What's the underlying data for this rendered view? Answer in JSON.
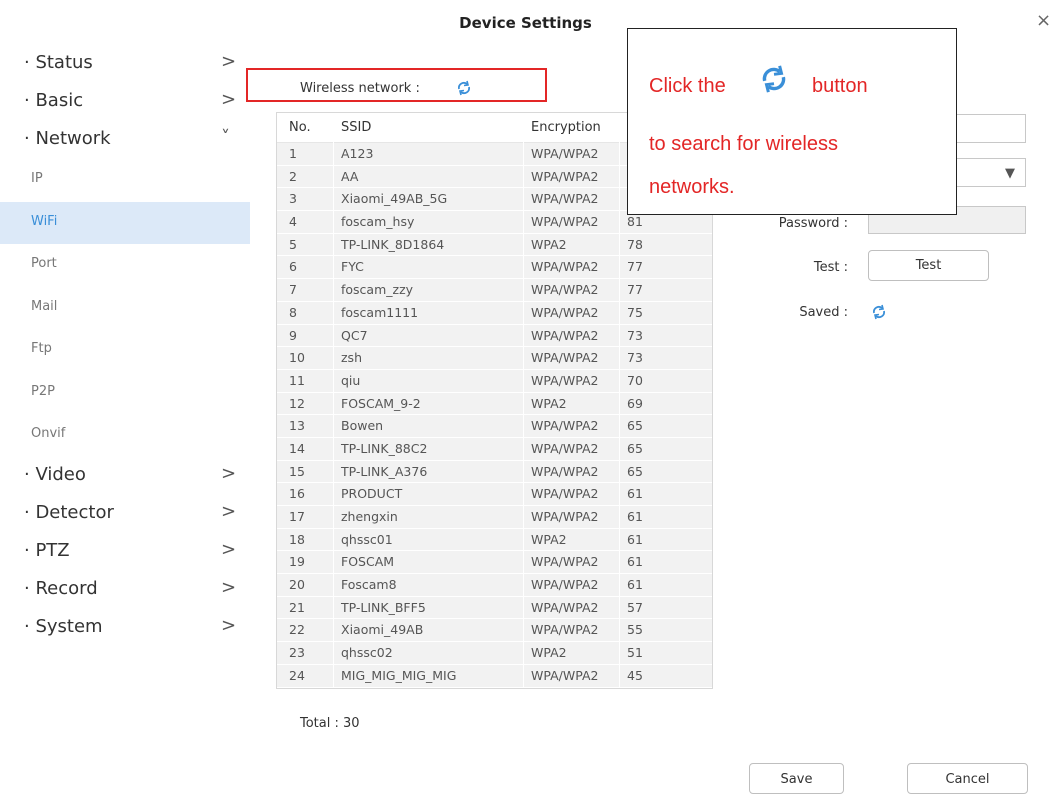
{
  "window": {
    "title": "Device Settings",
    "close_glyph": "×"
  },
  "sidebar": {
    "groups": [
      {
        "label": "· Status",
        "chevron": ">"
      },
      {
        "label": "· Basic",
        "chevron": ">"
      },
      {
        "label": "· Network",
        "chevron": "˅"
      }
    ],
    "network_items": [
      {
        "label": "IP"
      },
      {
        "label": "WiFi",
        "active": true
      },
      {
        "label": "Port"
      },
      {
        "label": "Mail"
      },
      {
        "label": "Ftp"
      },
      {
        "label": "P2P"
      },
      {
        "label": "Onvif"
      }
    ],
    "groups_after": [
      {
        "label": "· Video",
        "chevron": ">"
      },
      {
        "label": "· Detector",
        "chevron": ">"
      },
      {
        "label": "· PTZ",
        "chevron": ">"
      },
      {
        "label": "· Record",
        "chevron": ">"
      },
      {
        "label": "· System",
        "chevron": ">"
      }
    ]
  },
  "wireless": {
    "label": "Wireless network :",
    "refresh_icon": "refresh-icon"
  },
  "table": {
    "headers": {
      "no": "No.",
      "ssid": "SSID",
      "encryption": "Encryption"
    },
    "rows": [
      {
        "no": "1",
        "ssid": "A123",
        "enc": "WPA/WPA2",
        "sig": ""
      },
      {
        "no": "2",
        "ssid": "AA",
        "enc": "WPA/WPA2",
        "sig": ""
      },
      {
        "no": "3",
        "ssid": "Xiaomi_49AB_5G",
        "enc": "WPA/WPA2",
        "sig": ""
      },
      {
        "no": "4",
        "ssid": "foscam_hsy",
        "enc": "WPA/WPA2",
        "sig": "81"
      },
      {
        "no": "5",
        "ssid": "TP-LINK_8D1864",
        "enc": "WPA2",
        "sig": "78"
      },
      {
        "no": "6",
        "ssid": "FYC",
        "enc": "WPA/WPA2",
        "sig": "77"
      },
      {
        "no": "7",
        "ssid": "foscam_zzy",
        "enc": "WPA/WPA2",
        "sig": "77"
      },
      {
        "no": "8",
        "ssid": "foscam1111",
        "enc": "WPA/WPA2",
        "sig": "75"
      },
      {
        "no": "9",
        "ssid": "QC7",
        "enc": "WPA/WPA2",
        "sig": "73"
      },
      {
        "no": "10",
        "ssid": "zsh",
        "enc": "WPA/WPA2",
        "sig": "73"
      },
      {
        "no": "11",
        "ssid": "qiu",
        "enc": "WPA/WPA2",
        "sig": "70"
      },
      {
        "no": "12",
        "ssid": "FOSCAM_9-2",
        "enc": "WPA2",
        "sig": "69"
      },
      {
        "no": "13",
        "ssid": "Bowen",
        "enc": "WPA/WPA2",
        "sig": "65"
      },
      {
        "no": "14",
        "ssid": "TP-LINK_88C2",
        "enc": "WPA/WPA2",
        "sig": "65"
      },
      {
        "no": "15",
        "ssid": "TP-LINK_A376",
        "enc": "WPA/WPA2",
        "sig": "65"
      },
      {
        "no": "16",
        "ssid": "PRODUCT",
        "enc": "WPA/WPA2",
        "sig": "61"
      },
      {
        "no": "17",
        "ssid": "zhengxin",
        "enc": "WPA/WPA2",
        "sig": "61"
      },
      {
        "no": "18",
        "ssid": "qhssc01",
        "enc": "WPA2",
        "sig": "61"
      },
      {
        "no": "19",
        "ssid": "FOSCAM",
        "enc": "WPA/WPA2",
        "sig": "61"
      },
      {
        "no": "20",
        "ssid": "Foscam8",
        "enc": "WPA/WPA2",
        "sig": "61"
      },
      {
        "no": "21",
        "ssid": "TP-LINK_BFF5",
        "enc": "WPA/WPA2",
        "sig": "57"
      },
      {
        "no": "22",
        "ssid": "Xiaomi_49AB",
        "enc": "WPA/WPA2",
        "sig": "55"
      },
      {
        "no": "23",
        "ssid": "qhssc02",
        "enc": "WPA2",
        "sig": "51"
      },
      {
        "no": "24",
        "ssid": "MIG_MIG_MIG_MIG",
        "enc": "WPA/WPA2",
        "sig": "45"
      }
    ],
    "total": "Total : 30"
  },
  "form": {
    "password_label": "Password :",
    "test_label": "Test :",
    "test_button": "Test",
    "saved_label": "Saved :",
    "dropdown_arrow": "▼"
  },
  "footer": {
    "save_button": "Save",
    "cancel_button": "Cancel"
  },
  "callout": {
    "line1_pre": "Click the",
    "line1_post": "button",
    "line2": "to search for wireless",
    "line3": "networks."
  },
  "colors": {
    "accent_blue": "#3a8fd8",
    "callout_red": "#e32626",
    "active_row_bg": "#dce9f8",
    "row_bg": "#f2f2f2"
  }
}
